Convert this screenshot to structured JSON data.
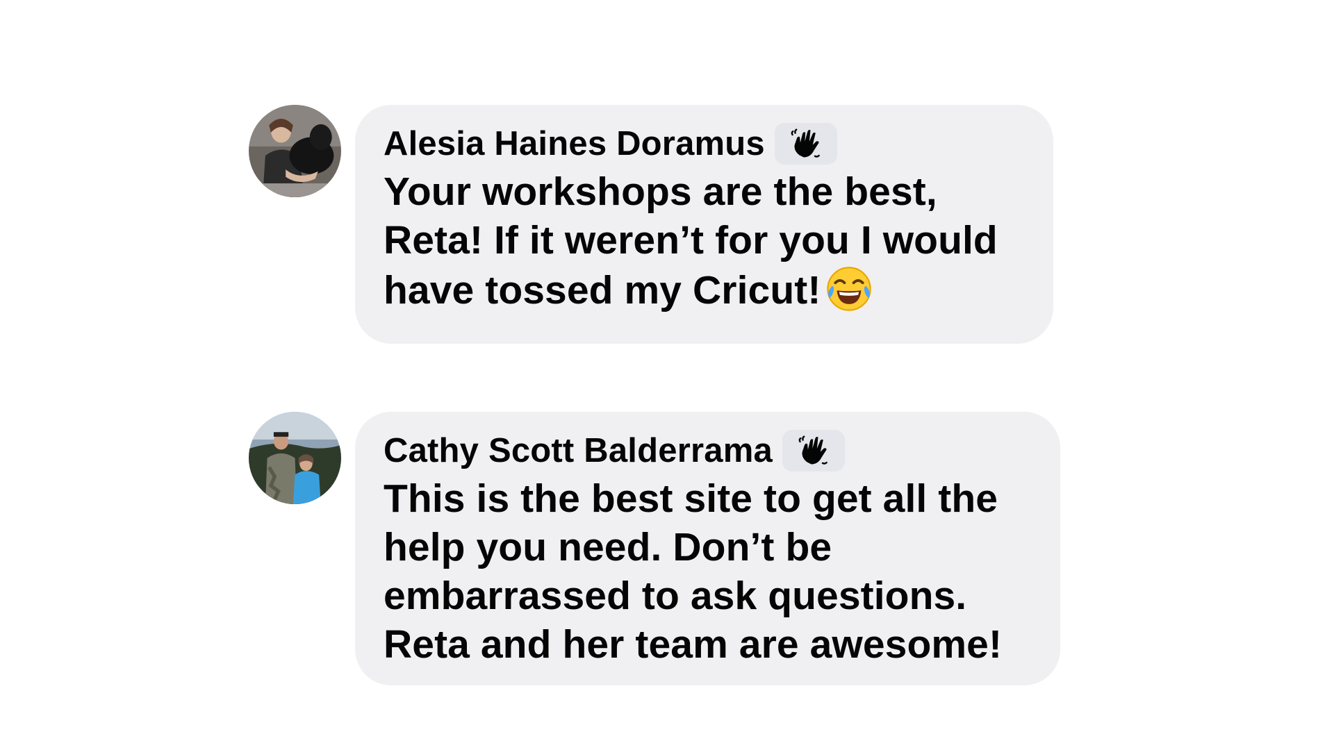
{
  "comments": [
    {
      "author": "Alesia Haines Doramus",
      "badge_icon": "waving-hand-icon",
      "text": "Your workshops are the best,\nReta! If it weren’t for you I would\nhave tossed my Cricut!",
      "trailing_emoji": "face-with-tears-of-joy-icon"
    },
    {
      "author": "Cathy Scott Balderrama",
      "badge_icon": "waving-hand-icon",
      "text": "This is the best site to get all the\nhelp you need. Don’t be\nembarrassed to ask questions.\nReta and her team are awesome!"
    }
  ],
  "colors": {
    "bubble": "#f0f0f2",
    "badge": "#e4e6eb",
    "text": "#050505"
  }
}
